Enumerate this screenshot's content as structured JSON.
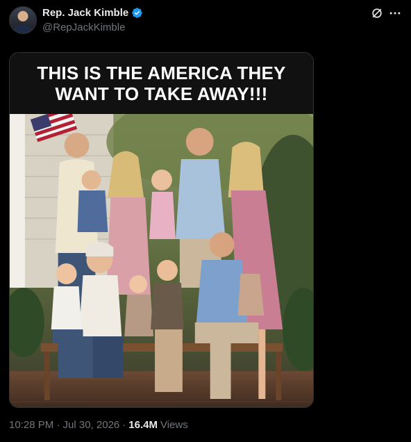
{
  "tweet": {
    "author": {
      "display_name": "Rep. Jack Kimble",
      "handle": "@RepJackKimble",
      "verified": true,
      "avatar_icon": "avatar-image"
    },
    "header_actions": {
      "grok_icon": "grok-icon",
      "more_icon": "more-icon"
    },
    "media": {
      "caption": "THIS IS THE AMERICA THEY WANT TO TAKE AWAY!!!",
      "type": "image"
    },
    "meta": {
      "timestamp": "10:28 PM · Jul 30, 2026",
      "separator": "·",
      "views_count": "16.4M",
      "views_label": "Views"
    }
  },
  "colors": {
    "background": "#000000",
    "primary_text": "#e7e9ea",
    "secondary_text": "#71767b",
    "verified_blue": "#1d9bf0"
  }
}
